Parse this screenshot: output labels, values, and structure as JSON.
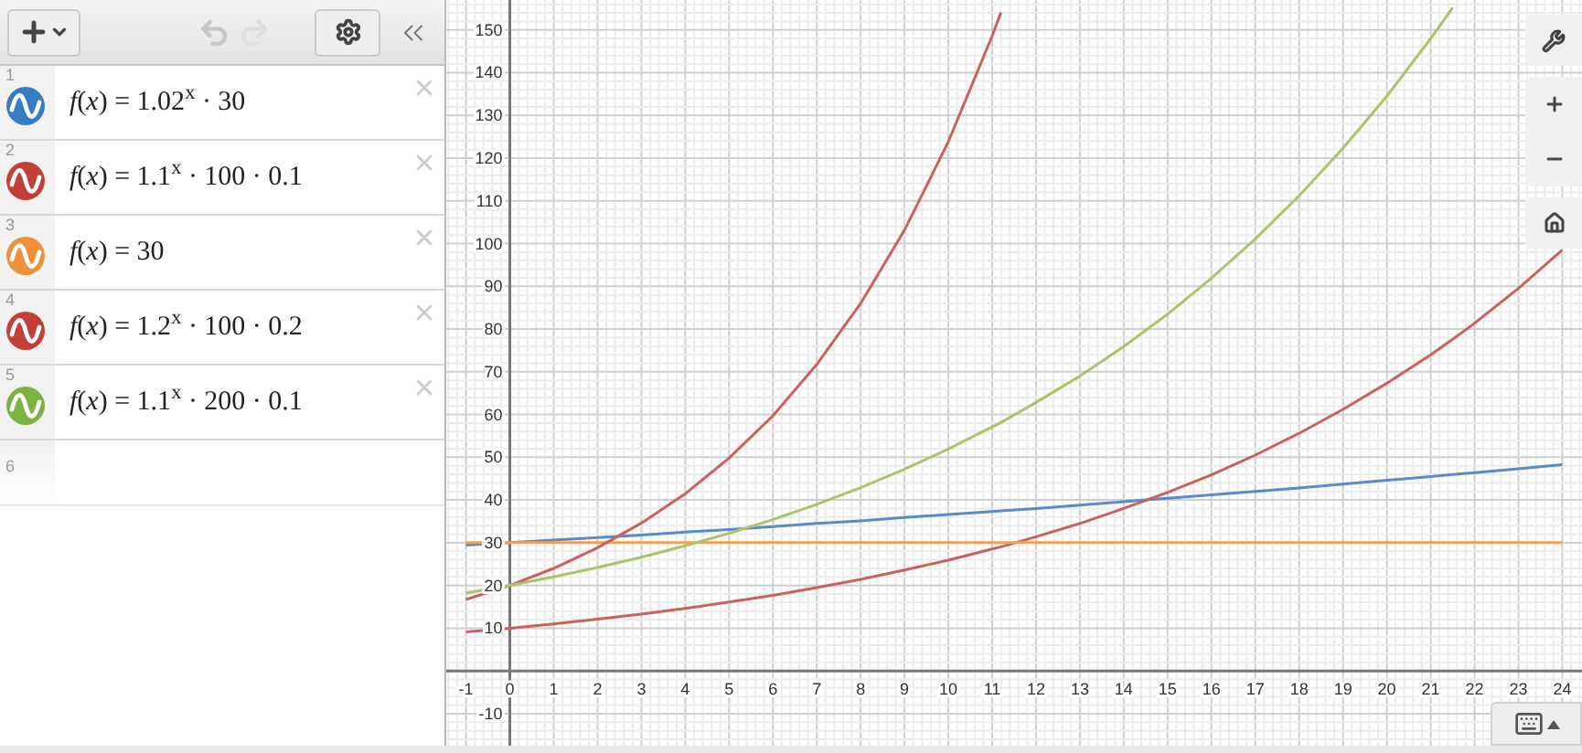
{
  "toolbar": {
    "undo_disabled": true,
    "redo_disabled": true
  },
  "expressions": [
    {
      "number": "1",
      "color": "#3a7cc4",
      "latex": "*f*(*x*) = 1.02$^{x}$ · 30"
    },
    {
      "number": "2",
      "color": "#c2403a",
      "latex": "*f*(*x*) = 1.1$^{x}$ · 100 · 0.1"
    },
    {
      "number": "3",
      "color": "#f0903a",
      "latex": "*f*(*x*) = 30"
    },
    {
      "number": "4",
      "color": "#c2403a",
      "latex": "*f*(*x*) = 1.2$^{x}$ · 100 · 0.2"
    },
    {
      "number": "5",
      "color": "#7cb342",
      "latex": "*f*(*x*) = 1.1$^{x}$ · 200 · 0.1"
    },
    {
      "number": "6"
    }
  ],
  "graph": {
    "chart_data": {
      "type": "line",
      "x": [
        -1,
        0,
        1,
        2,
        3,
        4,
        5,
        6,
        7,
        8,
        9,
        10,
        11,
        11.2,
        12,
        13,
        14,
        15,
        16,
        17,
        18,
        19,
        20,
        21,
        21.5,
        22,
        23,
        24
      ],
      "grid": true,
      "xlim": [
        -1.45,
        24.45
      ],
      "ylim": [
        -17.5,
        157
      ],
      "xticks": [
        -1,
        0,
        1,
        2,
        3,
        4,
        5,
        6,
        7,
        8,
        9,
        10,
        11,
        12,
        13,
        14,
        15,
        16,
        17,
        18,
        19,
        20,
        21,
        22,
        23,
        24
      ],
      "yticks": [
        -10,
        10,
        20,
        30,
        40,
        50,
        60,
        70,
        80,
        90,
        100,
        110,
        120,
        130,
        140,
        150
      ],
      "series": [
        {
          "color": "#5b8ac6",
          "values": [
            29.4,
            30,
            30.6,
            31.2,
            31.8,
            32.5,
            33.1,
            33.8,
            34.5,
            35.1,
            35.9,
            36.6,
            37.3,
            37.45,
            38.0,
            38.8,
            39.6,
            40.4,
            41.2,
            42.0,
            42.8,
            43.7,
            44.6,
            45.5,
            45.95,
            46.4,
            47.3,
            48.3
          ]
        },
        {
          "color": "#c9625e",
          "values": [
            9.1,
            10,
            11,
            12.1,
            13.3,
            14.6,
            16.1,
            17.7,
            19.5,
            21.4,
            23.6,
            25.9,
            28.5,
            29.05,
            31.4,
            34.5,
            38.0,
            41.8,
            45.9,
            50.5,
            55.6,
            61.2,
            67.3,
            74.0,
            77.6,
            81.4,
            89.5,
            98.5
          ]
        },
        {
          "color": "#f5a050",
          "values": [
            30,
            30,
            30,
            30,
            30,
            30,
            30,
            30,
            30,
            30,
            30,
            30,
            30,
            30,
            30,
            30,
            30,
            30,
            30,
            30,
            30,
            30,
            30,
            30,
            30,
            30,
            30,
            30
          ]
        },
        {
          "color": "#c9625e",
          "values": [
            16.7,
            20,
            24,
            28.8,
            34.6,
            41.5,
            49.8,
            59.7,
            71.7,
            86.0,
            103.2,
            123.8,
            148.6,
            154.1,
            null,
            null,
            null,
            null,
            null,
            null,
            null,
            null,
            null,
            null,
            null,
            null,
            null,
            null
          ]
        },
        {
          "color": "#a9c46a",
          "values": [
            18.2,
            20,
            22,
            24.2,
            26.6,
            29.3,
            32.2,
            35.4,
            39.0,
            42.9,
            47.2,
            51.9,
            57.1,
            58.1,
            62.8,
            69.0,
            75.9,
            83.5,
            91.9,
            101.1,
            111.2,
            122.3,
            134.5,
            148.0,
            155.2,
            null,
            null,
            null
          ]
        }
      ]
    }
  }
}
